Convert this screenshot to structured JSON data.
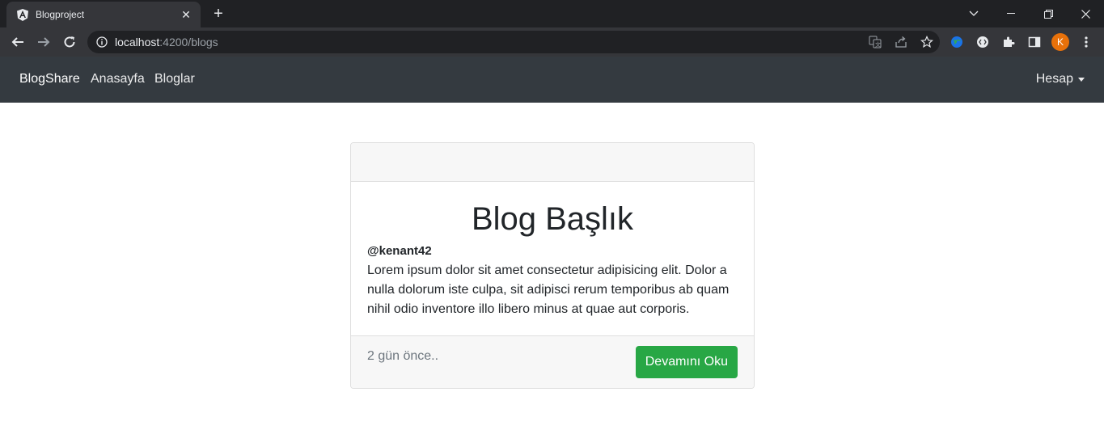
{
  "browser": {
    "tab_title": "Blogproject",
    "new_tab_label": "+",
    "url_host": "localhost",
    "url_rest": ":4200/blogs",
    "profile_initial": "K"
  },
  "navbar": {
    "brand": "BlogShare",
    "links": [
      "Anasayfa",
      "Bloglar"
    ],
    "account": "Hesap"
  },
  "post": {
    "title": "Blog Başlık",
    "author": "@kenant42",
    "body": "Lorem ipsum dolor sit amet consectetur adipisicing elit. Dolor a nulla dolorum iste culpa, sit adipisci rerum temporibus ab quam nihil odio inventore illo libero minus at quae aut corporis.",
    "time": "2 gün önce..",
    "button": "Devamını Oku"
  },
  "colors": {
    "navbar_bg": "#343a40",
    "button_bg": "#28a745",
    "avatar_bg": "#e8710a"
  }
}
